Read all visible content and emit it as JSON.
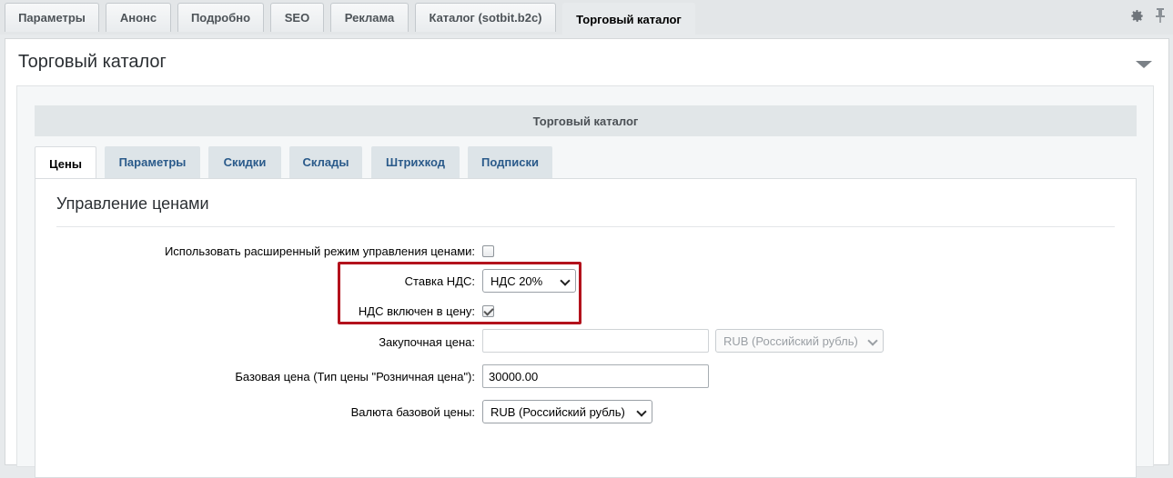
{
  "top_tabs": [
    {
      "label": "Параметры",
      "active": false
    },
    {
      "label": "Анонс",
      "active": false
    },
    {
      "label": "Подробно",
      "active": false
    },
    {
      "label": "SEO",
      "active": false
    },
    {
      "label": "Реклама",
      "active": false
    },
    {
      "label": "Каталог (sotbit.b2c)",
      "active": false
    },
    {
      "label": "Торговый каталог",
      "active": true
    }
  ],
  "section": {
    "title": "Торговый каталог",
    "bar_title": "Торговый каталог"
  },
  "sub_tabs": [
    {
      "label": "Цены",
      "active": true
    },
    {
      "label": "Параметры",
      "active": false
    },
    {
      "label": "Скидки",
      "active": false
    },
    {
      "label": "Склады",
      "active": false
    },
    {
      "label": "Штрихкод",
      "active": false
    },
    {
      "label": "Подписки",
      "active": false
    }
  ],
  "price_panel": {
    "heading": "Управление ценами",
    "extended_mode": {
      "label": "Использовать расширенный режим управления ценами:",
      "checked": false
    },
    "vat_rate": {
      "label": "Ставка НДС:",
      "value": "НДС 20%"
    },
    "vat_included": {
      "label": "НДС включен в цену:",
      "checked": true
    },
    "purchase_price": {
      "label": "Закупочная цена:",
      "value": "",
      "currency": "RUB (Российский рубль)"
    },
    "base_price": {
      "label": "Базовая цена (Тип цены \"Розничная цена\"):",
      "value": "30000.00"
    },
    "base_currency": {
      "label": "Валюта базовой цены:",
      "value": "RUB (Российский рубль)"
    }
  },
  "colors": {
    "highlight": "#b3121c",
    "tab_link": "#2a5a8a"
  }
}
